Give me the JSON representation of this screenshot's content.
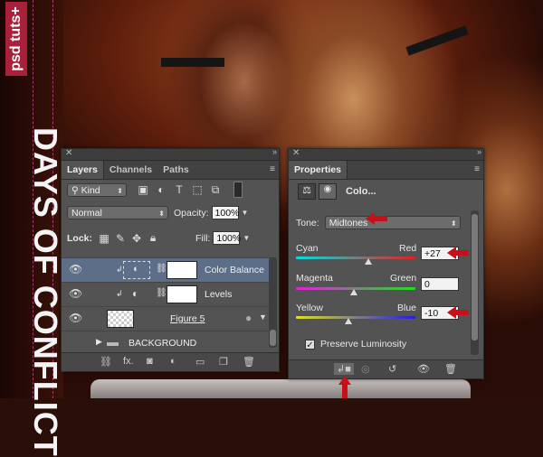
{
  "brand": "psd tuts+",
  "background_title": "DAYS OF CONFLICT",
  "layers_panel": {
    "tabs": [
      "Layers",
      "Channels",
      "Paths"
    ],
    "filter_label": "Kind",
    "blend_mode": "Normal",
    "opacity_label": "Opacity:",
    "opacity_value": "100%",
    "lock_label": "Lock:",
    "fill_label": "Fill:",
    "fill_value": "100%",
    "layers": [
      {
        "name": "Color Balance",
        "selected": true
      },
      {
        "name": "Levels",
        "selected": false
      },
      {
        "name": "Figure 5",
        "selected": false
      },
      {
        "name": "BACKGROUND",
        "selected": false
      }
    ],
    "footer_fx": "fx."
  },
  "properties_panel": {
    "tab": "Properties",
    "title": "Colo...",
    "tone_label": "Tone:",
    "tone_value": "Midtones",
    "sliders": [
      {
        "left": "Cyan",
        "right": "Red",
        "value": "+27",
        "pos": 0.6
      },
      {
        "left": "Magenta",
        "right": "Green",
        "value": "0",
        "pos": 0.5
      },
      {
        "left": "Yellow",
        "right": "Blue",
        "value": "-10",
        "pos": 0.46
      }
    ],
    "preserve_label": "Preserve Luminosity",
    "preserve_checked": true
  },
  "colors": {
    "accent_red": "#c8101a",
    "panel_bg": "#535353",
    "selected_row": "#5c6e88"
  }
}
